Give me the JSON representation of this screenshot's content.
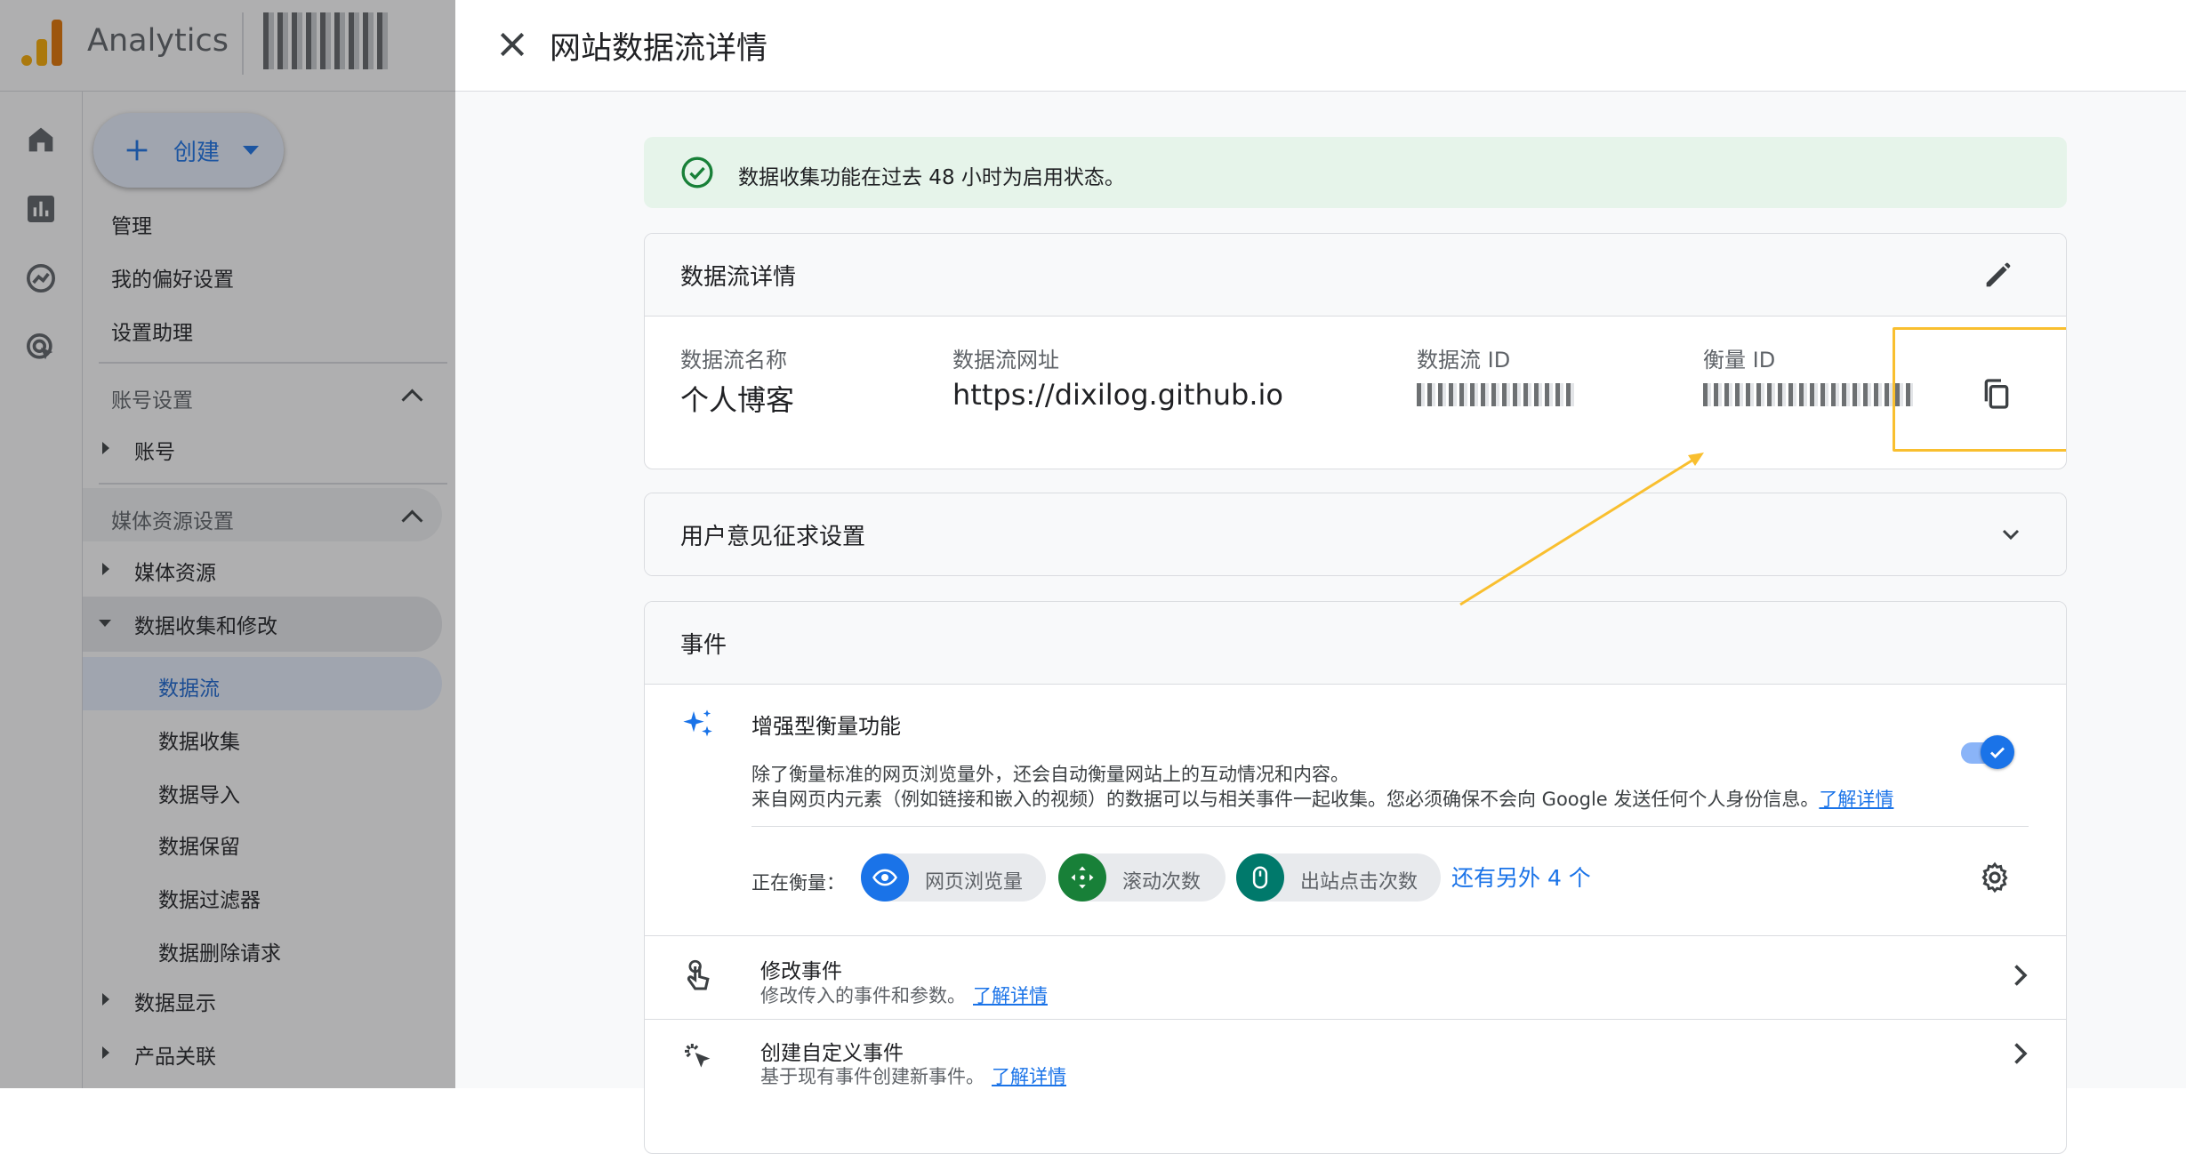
{
  "app": {
    "name": "Analytics"
  },
  "nav": {
    "create_label": "创建",
    "admin": "管理",
    "preferences": "我的偏好设置",
    "setup_assistant": "设置助理",
    "account_settings": "账号设置",
    "account": "账号",
    "property_settings": "媒体资源设置",
    "property": "媒体资源",
    "data_collection_modification": "数据收集和修改",
    "data_streams": "数据流",
    "data_collection": "数据收集",
    "data_import": "数据导入",
    "data_retention": "数据保留",
    "data_filters": "数据过滤器",
    "data_deletion": "数据删除请求",
    "data_display": "数据显示",
    "product_links": "产品关联"
  },
  "panel": {
    "title": "网站数据流详情",
    "banner": "数据收集功能在过去 48 小时为启用状态。",
    "details": {
      "title": "数据流详情",
      "name_label": "数据流名称",
      "name_value": "个人博客",
      "url_label": "数据流网址",
      "url_value": "https://dixilog.github.io",
      "stream_id_label": "数据流 ID",
      "measurement_id_label": "衡量 ID"
    },
    "consent": {
      "title": "用户意见征求设置"
    },
    "events": {
      "title": "事件",
      "enhanced": {
        "title": "增强型衡量功能",
        "desc1": "除了衡量标准的网页浏览量外，还会自动衡量网站上的互动情况和内容。",
        "desc2": "来自网页内元素（例如链接和嵌入的视频）的数据可以与相关事件一起收集。您必须确保不会向 Google 发送任何个人身份信息。",
        "learn_more": "了解详情",
        "toggle_on": true
      },
      "measuring_label": "正在衡量：",
      "chips": [
        "网页浏览量",
        "滚动次数",
        "出站点击次数"
      ],
      "more": "还有另外 4 个",
      "modify": {
        "title": "修改事件",
        "desc": "修改传入的事件和参数。",
        "learn_more": "了解详情"
      },
      "custom": {
        "title": "创建自定义事件",
        "desc": "基于现有事件创建新事件。",
        "learn_more": "了解详情"
      }
    }
  },
  "colors": {
    "accent": "#1a73e8",
    "highlight": "#f9bf2f",
    "banner_bg": "#e6f4ea",
    "success": "#188038",
    "chip_blue": "#1a73e8",
    "chip_green": "#188038",
    "chip_teal": "#00796b"
  }
}
